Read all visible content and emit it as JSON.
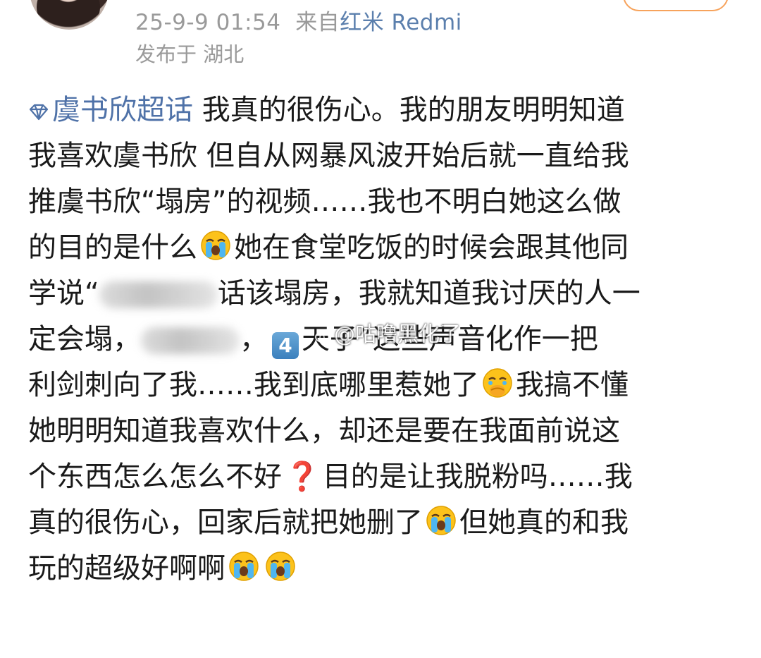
{
  "header": {
    "timestamp": "25-9-9 01:54",
    "source_prefix": "来自",
    "device": "红米 Redmi",
    "location": "发布于 湖北"
  },
  "post": {
    "topic": "虞书欣超话",
    "lines": [
      {
        "a": "我真的很伤心。我的朋友明明知道"
      },
      {
        "a": "我喜欢虞书欣 但自从网暴风波开始后就一直给我"
      },
      {
        "a": "推虞书欣“塌房”的视频……我也不明白她这么做"
      },
      {
        "a": "的目的是什么",
        "b": "她在食堂吃饭的时候会跟其他同"
      },
      {
        "a": "学说“",
        "b": "话该塌房，我就知道我讨厌的人一"
      },
      {
        "a": "定会塌，",
        "b": "，",
        "key": "4",
        "c": "天子”这些声音化作一把"
      },
      {
        "a": "利剑刺向了我……我到底哪里惹她了",
        "b": "我搞不懂"
      },
      {
        "a": "她明明知道我喜欢什么，却还是要在我面前说这"
      },
      {
        "a": "个东西怎么怎么不好",
        "q": "❓",
        "b": "目的是让我脱粉吗……我"
      },
      {
        "a": "真的很伤心，回家后就把她删了",
        "b": "但她真的和我"
      },
      {
        "a": "玩的超级好啊啊"
      }
    ],
    "watermark": "@咕噜黑化了"
  },
  "icons": {
    "topic": "diamond-topic-icon",
    "crying": "loudly-crying-face-icon",
    "holding_back_tears": "face-holding-back-tears-icon",
    "keycap": "keycap-digit-four-icon",
    "question": "red-question-mark-icon",
    "watermark": "weibo-logo-icon"
  },
  "colors": {
    "topic_link": "#4f72a8",
    "device_link": "#5b7fad",
    "meta_gray": "#9a9a9a",
    "follow_border": "#f7a35c"
  }
}
